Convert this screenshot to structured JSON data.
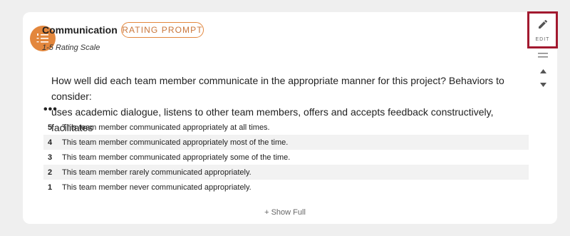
{
  "card": {
    "icon": "numbered-list-icon",
    "title": "Communication",
    "type_badge": "RATING PROMPT",
    "subtitle": "1-5 Rating Scale",
    "prompt_line1": "How well did each team member communicate in the appropriate manner for this project? Behaviors to consider:",
    "prompt_line2": "uses academic dialogue, listens to other team members, offers and accepts feedback constructively, facilitates",
    "ellipsis": "•••",
    "scale": [
      {
        "value": "5",
        "text": "This team member communicated appropriately at all times."
      },
      {
        "value": "4",
        "text": "This team member communicated appropriately most of the time."
      },
      {
        "value": "3",
        "text": "This team member communicated appropriately some of the time."
      },
      {
        "value": "2",
        "text": "This team member rarely communicated appropriately."
      },
      {
        "value": "1",
        "text": "This team member never communicated appropriately."
      }
    ],
    "show_full": "+ Show Full"
  },
  "actions": {
    "edit_label": "EDIT",
    "edit_icon": "pencil-icon",
    "drag_icon": "drag-handle-icon",
    "up_icon": "arrow-up-icon",
    "down_icon": "arrow-down-icon"
  },
  "colors": {
    "accent": "#e3873d",
    "highlight_border": "#a2192f",
    "background": "#efefef"
  }
}
